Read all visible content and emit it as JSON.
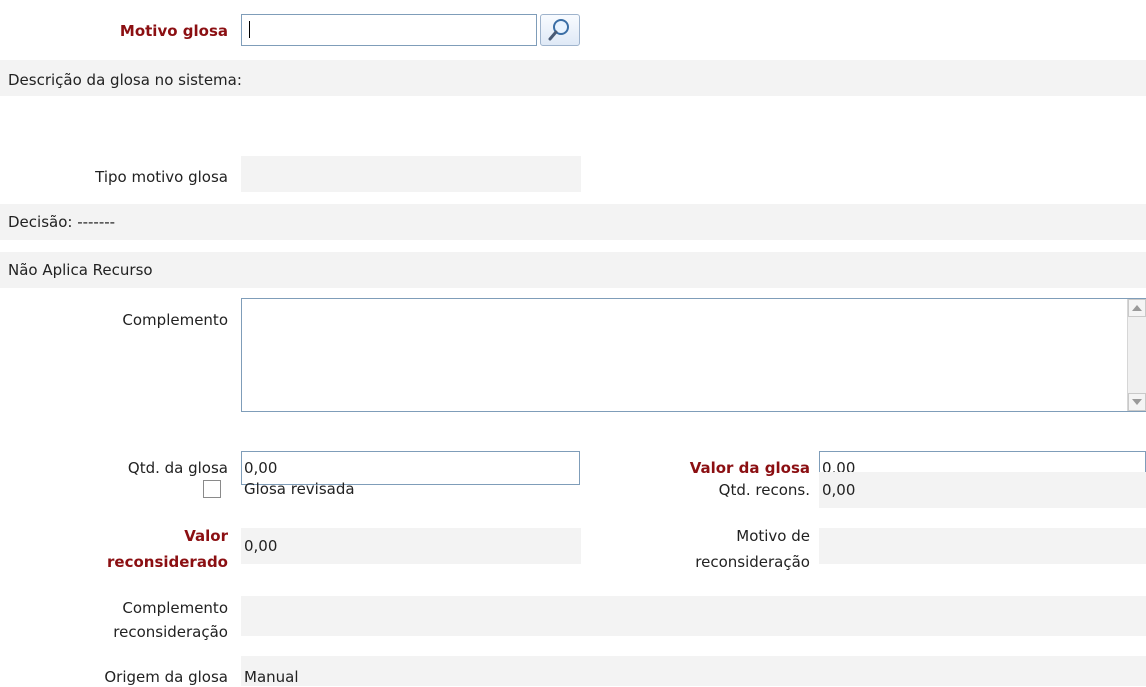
{
  "motivo_glosa": {
    "label": "Motivo glosa",
    "value": ""
  },
  "descricao": {
    "label": "Descrição da glosa no sistema:"
  },
  "tipo_motivo": {
    "label": "Tipo motivo glosa",
    "value": ""
  },
  "decisao": {
    "label": "Decisão: -------"
  },
  "nao_aplica": {
    "label": "Não Aplica Recurso"
  },
  "complemento": {
    "label": "Complemento",
    "value": ""
  },
  "qtd_glosa": {
    "label": "Qtd. da glosa",
    "value": "0,00"
  },
  "valor_glosa": {
    "label": "Valor da glosa",
    "value": "0,00"
  },
  "glosa_revisada": {
    "label": "Glosa revisada",
    "checked": false
  },
  "qtd_recons": {
    "label": "Qtd. recons.",
    "value": "0,00"
  },
  "valor_reconsiderado": {
    "label_line1": "Valor",
    "label_line2": "reconsiderado",
    "value": "0,00"
  },
  "motivo_reconsideracao": {
    "label_line1": "Motivo de",
    "label_line2": "reconsideração",
    "value": ""
  },
  "complemento_reconsideracao": {
    "label_line1": "Complemento",
    "label_line2": "reconsideração",
    "value": ""
  },
  "origem_glosa": {
    "label": "Origem da glosa",
    "value": "Manual"
  },
  "colors": {
    "required_label": "#8b0f12",
    "field_border": "#7f9db9",
    "readonly_bg": "#f3f3f3"
  },
  "icons": {
    "search": "magnifier-icon"
  }
}
